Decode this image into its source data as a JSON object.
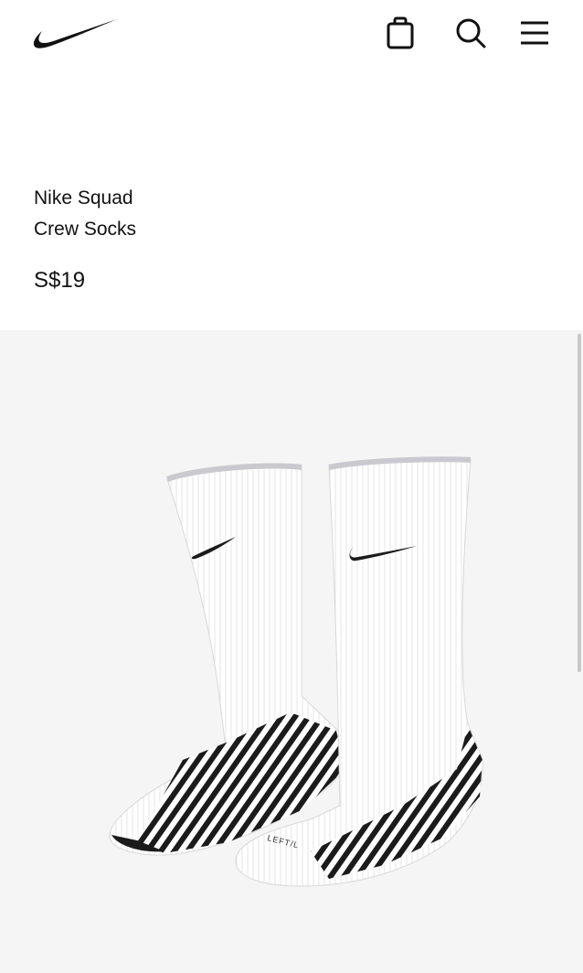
{
  "header": {
    "logo_icon": "nike-swoosh-icon",
    "bag_icon": "shopping-bag-icon",
    "search_icon": "search-icon",
    "menu_icon": "hamburger-menu-icon"
  },
  "product": {
    "name_line1": "Nike Squad",
    "name_line2": "Crew Socks",
    "price": "S$19",
    "sock_label": "LEFT/L"
  },
  "colors": {
    "background": "#ffffff",
    "image_background": "#f5f5f5",
    "text": "#111111"
  }
}
